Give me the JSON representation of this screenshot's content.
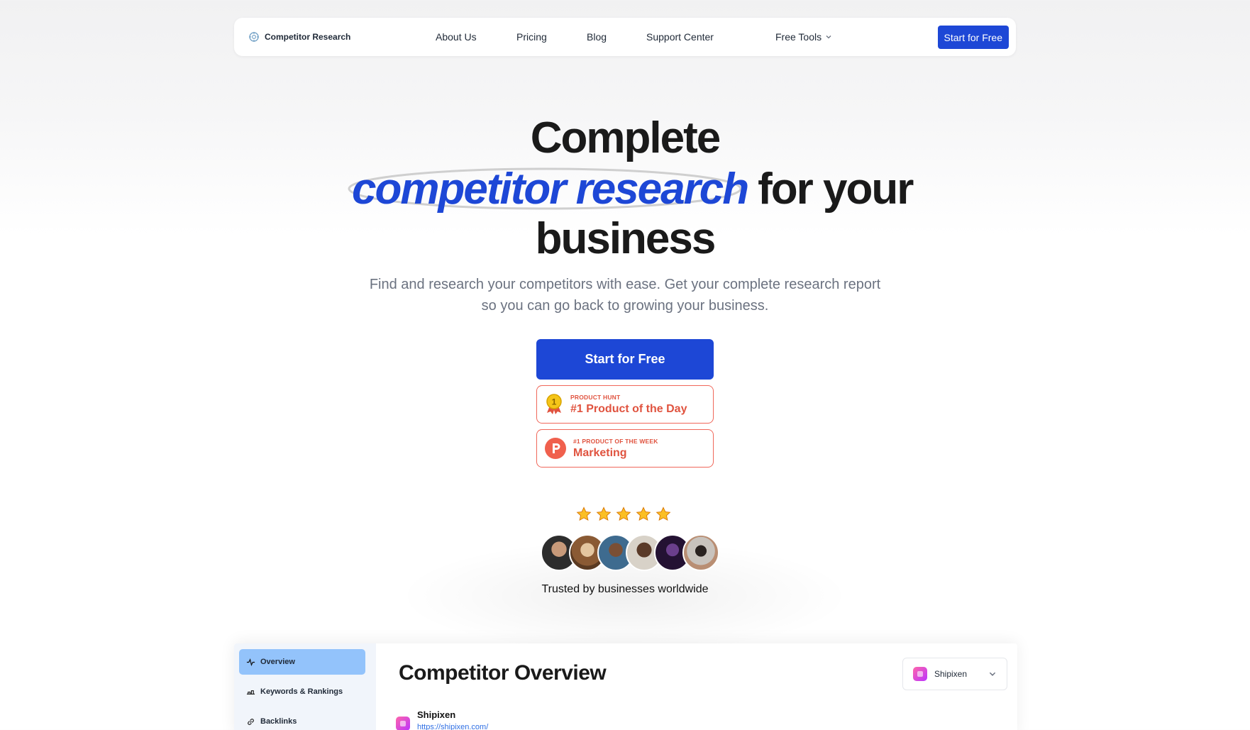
{
  "nav": {
    "brand": "Competitor Research",
    "links": [
      "About Us",
      "Pricing",
      "Blog",
      "Support Center",
      "Free Tools"
    ],
    "cta": "Start for Free"
  },
  "hero": {
    "line1": "Complete",
    "highlight": "competitor research",
    "line2_rest": "for your",
    "line3": "business",
    "subtitle_line1": "Find and research your competitors with ease. Get your complete research report",
    "subtitle_line2": "so you can go back to growing your business.",
    "cta": "Start for Free"
  },
  "badges": [
    {
      "small": "PRODUCT HUNT",
      "large": "#1 Product of the Day",
      "icon": "gold-medal-icon"
    },
    {
      "small": "#1 PRODUCT OF THE WEEK",
      "large": "Marketing",
      "icon": "product-hunt-logo-icon"
    }
  ],
  "rating": {
    "stars": 5,
    "max": 5
  },
  "avatars_count": 6,
  "trusted": "Trusted by businesses worldwide",
  "app": {
    "sidebar": [
      "Overview",
      "Keywords & Rankings",
      "Backlinks"
    ],
    "title": "Competitor Overview",
    "selected": "Shipixen",
    "competitor": {
      "name": "Shipixen",
      "url": "https://shipixen.com/"
    }
  },
  "colors": {
    "brand": "#1d47d6",
    "badge": "#e0533f",
    "sidebar_active": "#93c3fb"
  }
}
